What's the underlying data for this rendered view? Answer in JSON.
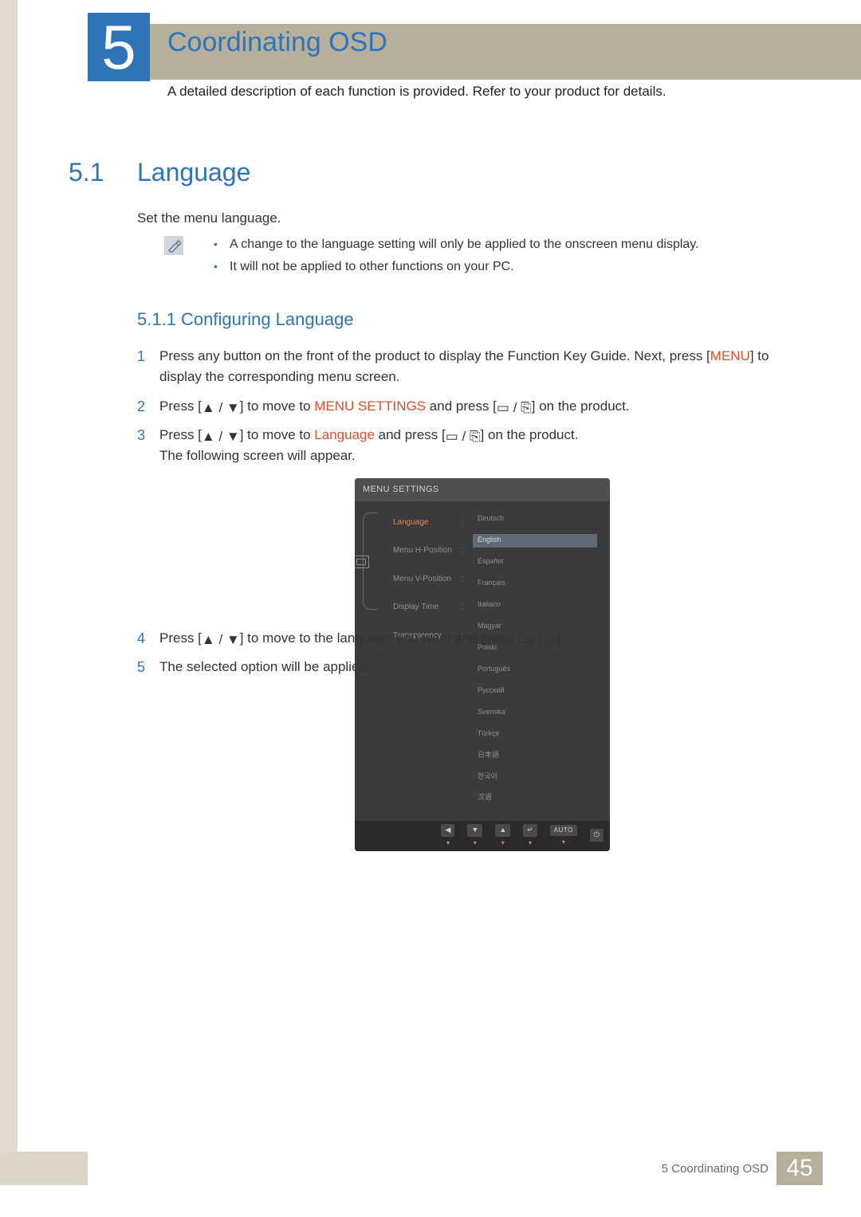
{
  "chapter": {
    "number": "5",
    "title": "Coordinating OSD",
    "intro": "A detailed description of each function is provided. Refer to your product for details."
  },
  "section": {
    "number": "5.1",
    "title": "Language",
    "intro": "Set the menu language.",
    "notes": [
      "A change to the language setting will only be applied to the onscreen menu display.",
      "It will not be applied to other functions on your PC."
    ]
  },
  "subsection": {
    "number_title": "5.1.1   Configuring Language"
  },
  "steps": {
    "s1a": "Press any button on the front of the product to display the Function Key Guide. Next, press [",
    "s1_menu": "MENU",
    "s1b": "] to display the corresponding menu screen.",
    "s2a": "Press [",
    "s2b": "] to move to ",
    "s2_hl": "MENU SETTINGS",
    "s2c": " and press [",
    "s2d": "] on the product.",
    "s3a": "Press [",
    "s3b": "] to move to ",
    "s3_hl": "Language",
    "s3c": " and press [",
    "s3d": "] on the product.",
    "s3e": "The following screen will appear.",
    "s4a": "Press [",
    "s4b": "] to move to the language you want and press [",
    "s4c": "].",
    "s5": "The selected option will be applied."
  },
  "osd": {
    "title": "MENU SETTINGS",
    "left_items": [
      {
        "label": "Language",
        "active": true
      },
      {
        "label": "Menu H-Position",
        "active": false
      },
      {
        "label": "Menu V-Position",
        "active": false
      },
      {
        "label": "Display Time",
        "active": false
      },
      {
        "label": "Transparency",
        "active": false
      }
    ],
    "right_items": [
      {
        "label": "Deutsch",
        "selected": false
      },
      {
        "label": "English",
        "selected": true
      },
      {
        "label": "Español",
        "selected": false
      },
      {
        "label": "Français",
        "selected": false
      },
      {
        "label": "Italiano",
        "selected": false
      },
      {
        "label": "Magyar",
        "selected": false
      },
      {
        "label": "Polski",
        "selected": false
      },
      {
        "label": "Português",
        "selected": false
      },
      {
        "label": "Русский",
        "selected": false
      },
      {
        "label": "Svenska",
        "selected": false
      },
      {
        "label": "Türkçe",
        "selected": false
      },
      {
        "label": "日本語",
        "selected": false
      },
      {
        "label": "한국어",
        "selected": false
      },
      {
        "label": "汉语",
        "selected": false
      }
    ],
    "bar": {
      "back": "◀",
      "down": "▼",
      "up": "▲",
      "enter": "↵",
      "auto": "AUTO",
      "power": "⏻",
      "caret": "▾"
    }
  },
  "footer": {
    "chapter_label": "5 Coordinating OSD",
    "page": "45"
  },
  "glyphs": {
    "triUp": "▲",
    "triDown": "▼",
    "slash": " / ",
    "rect": "▭",
    "enterRect": "⎘"
  }
}
